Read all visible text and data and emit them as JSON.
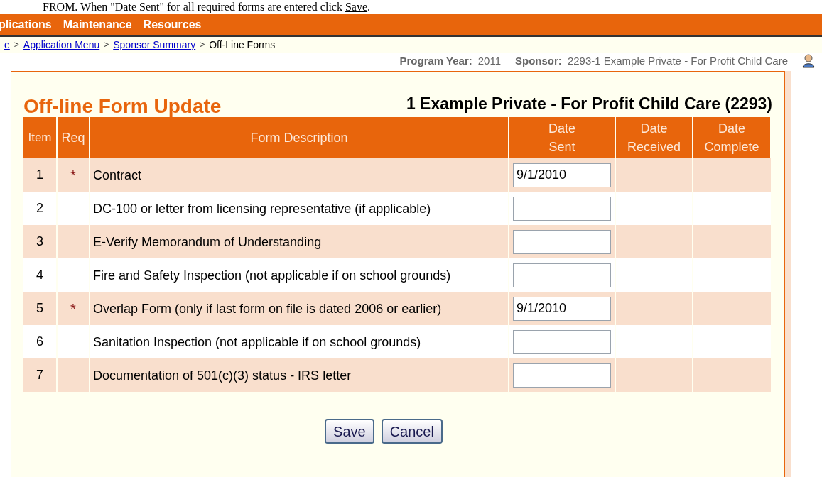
{
  "instruction": {
    "text": "FROM.  When \"Date Sent\" for all required forms are entered click",
    "link": "Save",
    "end": "."
  },
  "menu": [
    "plications",
    "Maintenance",
    "Resources"
  ],
  "separator": ">",
  "breadcrumb": [
    {
      "label": "e",
      "link": true
    },
    {
      "label": "Application Menu",
      "link": true
    },
    {
      "label": "Sponsor Summary",
      "link": true
    },
    {
      "label": "Off-Line Forms",
      "link": false
    }
  ],
  "info": [
    {
      "label": "Program Year:",
      "value": "2011"
    },
    {
      "label": "Sponsor:",
      "value": "2293-1 Example Private - For Profit Child Care"
    }
  ],
  "title": "Off-line Form Update",
  "sponsor_name": "1 Example Private - For Profit Child Care (2293)",
  "columns": [
    "Item",
    "Req",
    "Form Description",
    "Date Sent",
    "Date Received",
    "Date Complete"
  ],
  "rows": [
    {
      "item": "1",
      "required": true,
      "description": "Contract",
      "date_sent": "9/1/2010"
    },
    {
      "item": "2",
      "required": false,
      "description": "DC-100 or letter from licensing representative (if applicable)",
      "date_sent": ""
    },
    {
      "item": "3",
      "required": false,
      "description": "E-Verify Memorandum of Understanding",
      "date_sent": ""
    },
    {
      "item": "4",
      "required": false,
      "description": "Fire and Safety Inspection (not applicable if on school grounds)",
      "date_sent": ""
    },
    {
      "item": "5",
      "required": true,
      "description": "Overlap Form (only if last form on file is dated 2006 or earlier)",
      "date_sent": "9/1/2010"
    },
    {
      "item": "6",
      "required": false,
      "description": "Sanitation Inspection (not applicable if on school grounds)",
      "date_sent": ""
    },
    {
      "item": "7",
      "required": false,
      "description": "Documentation of 501(c)(3) status - IRS letter",
      "date_sent": ""
    }
  ],
  "buttons": [
    "Save",
    "Cancel"
  ],
  "req_mark": "*"
}
